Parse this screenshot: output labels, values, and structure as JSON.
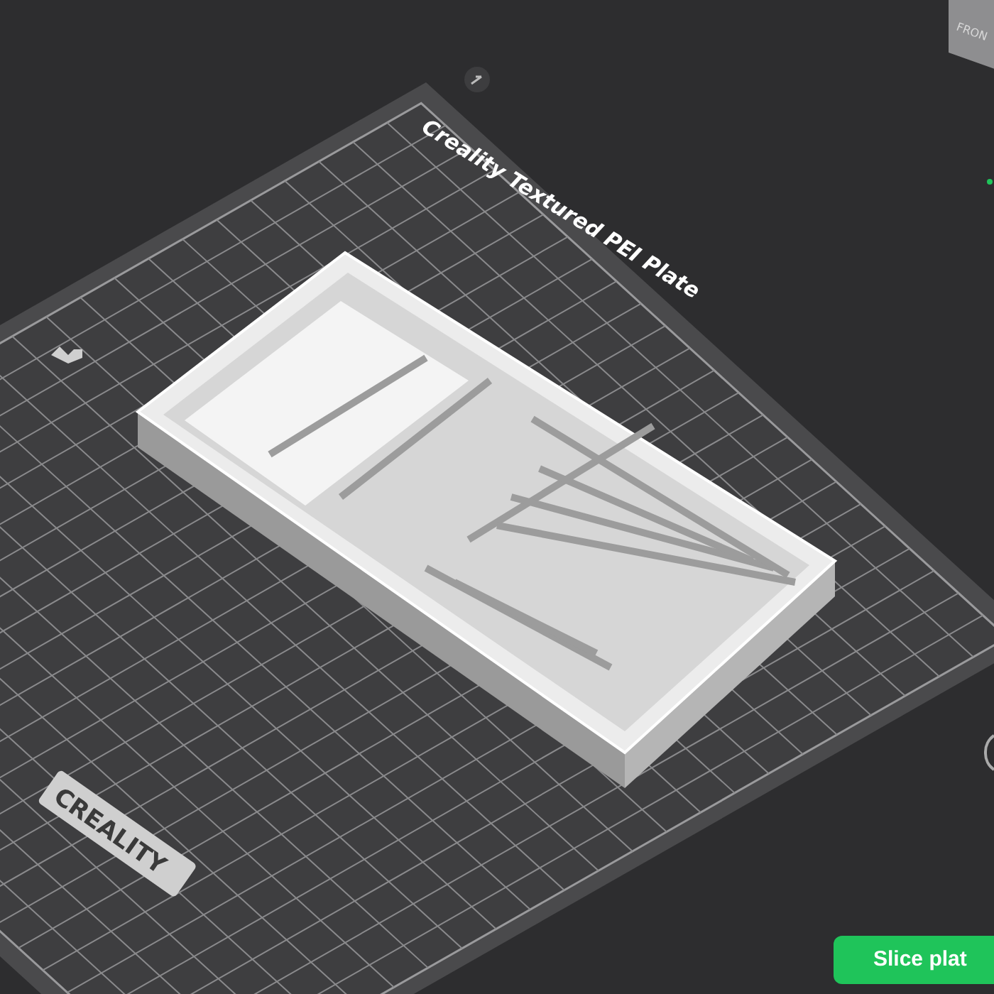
{
  "viewport": {
    "plate_label": "Creality Textured PEI Plate",
    "logo": "CREALITY",
    "view_cube": {
      "face_label": "FRON"
    }
  },
  "slice_button": {
    "label": "Slice plat"
  }
}
